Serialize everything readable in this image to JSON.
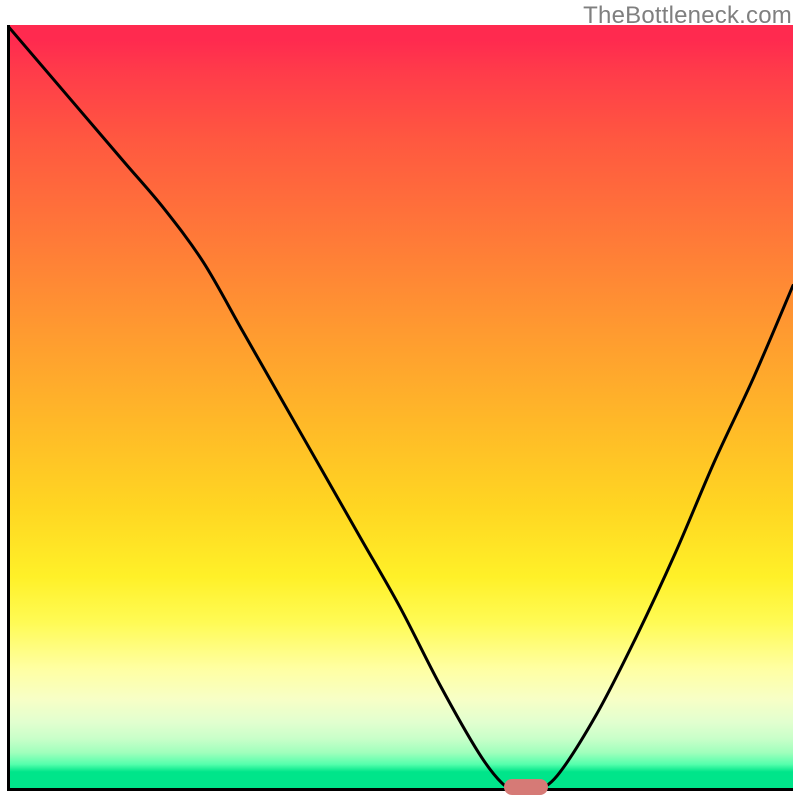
{
  "attribution": "TheBottleneck.com",
  "chart_data": {
    "type": "line",
    "title": "",
    "xlabel": "",
    "ylabel": "",
    "xlim": [
      0,
      100
    ],
    "ylim": [
      0,
      100
    ],
    "grid": false,
    "legend": false,
    "background": "warmth-gradient (red→green)",
    "series": [
      {
        "name": "bottleneck-curve",
        "x": [
          0,
          5,
          10,
          15,
          20,
          25,
          30,
          35,
          40,
          45,
          50,
          55,
          60,
          63,
          65,
          67,
          70,
          75,
          80,
          85,
          90,
          95,
          100
        ],
        "y": [
          100,
          94,
          88,
          82,
          76,
          69,
          60,
          51,
          42,
          33,
          24,
          14,
          5,
          1,
          0,
          0,
          2,
          10,
          20,
          31,
          43,
          54,
          66
        ]
      }
    ],
    "marker": {
      "name": "optimal-point",
      "x": 66,
      "y": 0,
      "color": "#d67a76"
    }
  }
}
